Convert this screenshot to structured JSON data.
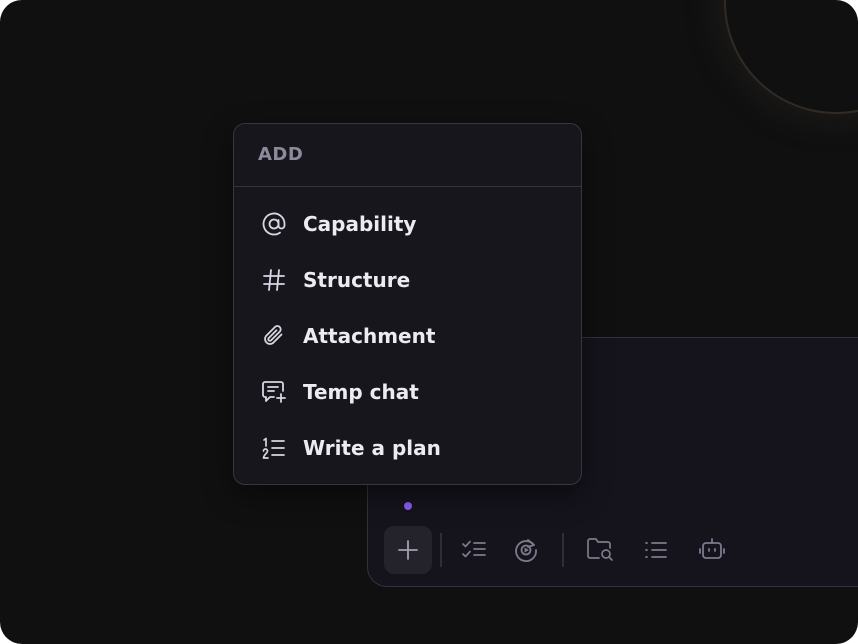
{
  "menu": {
    "header": "ADD",
    "items": [
      {
        "label": "Capability",
        "icon": "at-icon"
      },
      {
        "label": "Structure",
        "icon": "hash-icon"
      },
      {
        "label": "Attachment",
        "icon": "paperclip-icon"
      },
      {
        "label": "Temp chat",
        "icon": "chat-add-icon"
      },
      {
        "label": "Write a plan",
        "icon": "numbered-list-icon"
      }
    ]
  },
  "toolbar": {
    "buttons": [
      "plus-icon",
      "checklist-icon",
      "refresh-target-icon",
      "folder-search-icon",
      "bullet-list-icon",
      "robot-icon"
    ]
  },
  "colors": {
    "background": "#101011",
    "menu_bg": "#17161c",
    "composer_bg": "#15131c",
    "status_dot": "#8b5cf6",
    "text": "#ecebf2",
    "muted": "#8c8a9b"
  }
}
